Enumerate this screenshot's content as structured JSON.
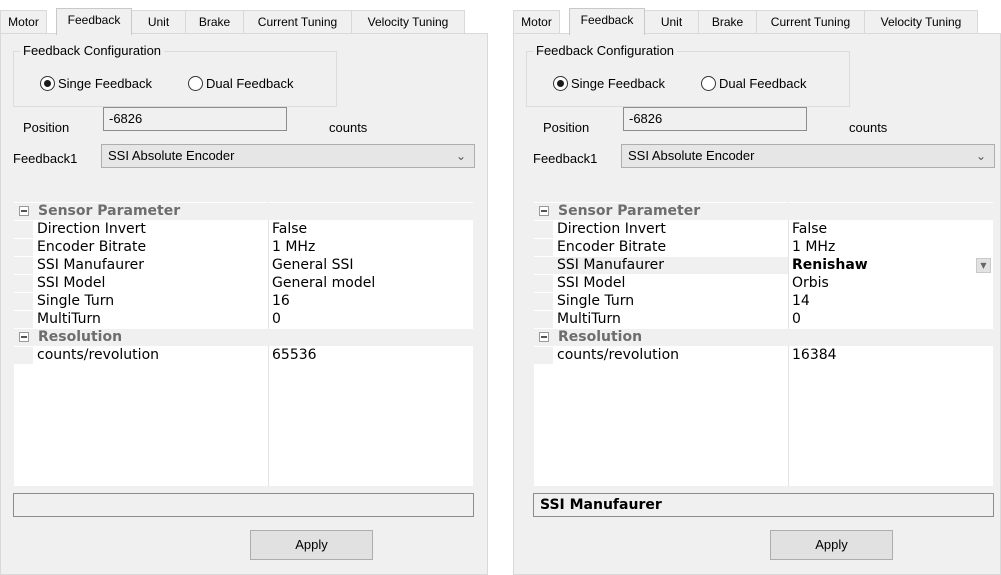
{
  "tabs": [
    "Motor",
    "Feedback",
    "Unit",
    "Brake",
    "Current Tuning",
    "Velocity Tuning"
  ],
  "left": {
    "group_title": "Feedback Configuration",
    "radio_single": "Singe Feedback",
    "radio_dual": "Dual Feedback",
    "selected_radio": "single",
    "position_label": "Position",
    "position_value": "-6826",
    "position_unit": "counts",
    "feedback1_label": "Feedback1",
    "feedback1_value": "SSI Absolute Encoder",
    "cat_sensor": "Sensor Parameter",
    "cat_resolution": "Resolution",
    "props": [
      {
        "name": "Direction Invert",
        "value": "False"
      },
      {
        "name": "Encoder Bitrate",
        "value": "1 MHz"
      },
      {
        "name": "SSI Manufaurer",
        "value": "General SSI"
      },
      {
        "name": "SSI Model",
        "value": "General model"
      },
      {
        "name": "Single Turn",
        "value": "16"
      },
      {
        "name": "MultiTurn",
        "value": "0"
      }
    ],
    "res_name": "counts/revolution",
    "res_value": "65536",
    "description": "",
    "apply_label": "Apply"
  },
  "right": {
    "group_title": "Feedback Configuration",
    "radio_single": "Singe Feedback",
    "radio_dual": "Dual Feedback",
    "selected_radio": "single",
    "position_label": "Position",
    "position_value": "-6826",
    "position_unit": "counts",
    "feedback1_label": "Feedback1",
    "feedback1_value": "SSI Absolute Encoder",
    "cat_sensor": "Sensor Parameter",
    "cat_resolution": "Resolution",
    "props": [
      {
        "name": "Direction Invert",
        "value": "False"
      },
      {
        "name": "Encoder Bitrate",
        "value": "1 MHz"
      },
      {
        "name": "SSI Manufaurer",
        "value": "Renishaw"
      },
      {
        "name": "SSI Model",
        "value": "Orbis"
      },
      {
        "name": "Single Turn",
        "value": "14"
      },
      {
        "name": "MultiTurn",
        "value": "0"
      }
    ],
    "res_name": "counts/revolution",
    "res_value": "16384",
    "description": "SSI Manufaurer",
    "apply_label": "Apply"
  },
  "icons": {
    "combo_arrow": "chevron-down-icon",
    "collapse": "minus-box-icon",
    "dropdown_button": "triangle-down-icon"
  }
}
